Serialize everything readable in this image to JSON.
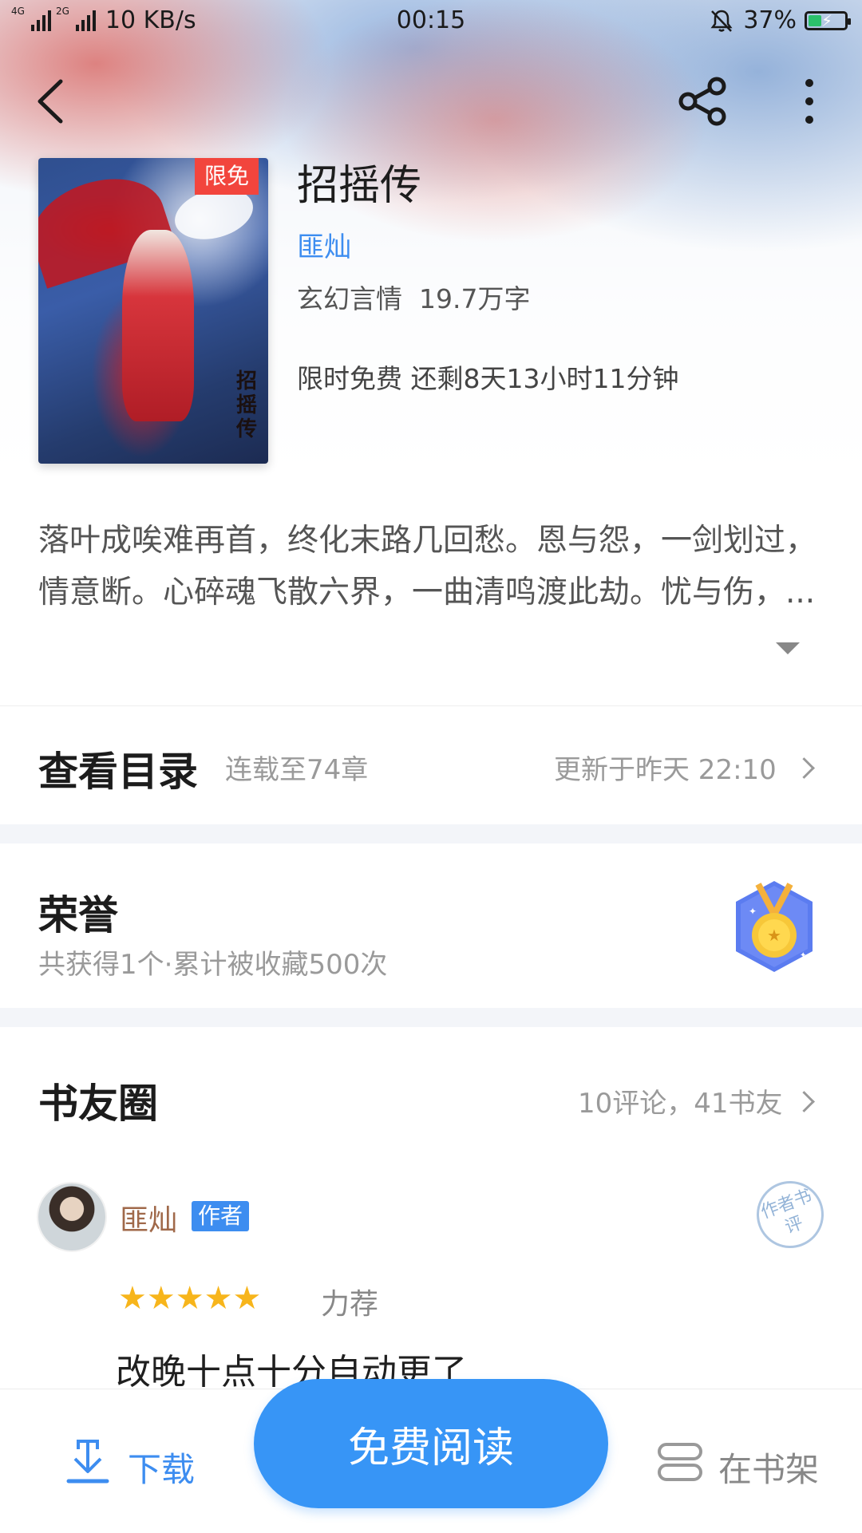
{
  "status_bar": {
    "network1": "4G",
    "network2": "2G",
    "speed": "10 KB/s",
    "time": "00:15",
    "battery": "37%",
    "battery_level": 0.37,
    "icons": [
      "signal-icon",
      "mute-bell-icon",
      "battery-icon"
    ]
  },
  "nav": {
    "back_icon": "back-arrow-icon",
    "share_icon": "share-icon",
    "more_icon": "more-vertical-icon"
  },
  "book": {
    "cover_badge": "限免",
    "cover_vertical_title": "招摇传",
    "title": "招摇传",
    "author": "匪灿",
    "meta": "玄幻言情  19.7万字",
    "free_info": "限时免费 还剩8天13小时11分钟"
  },
  "intro": {
    "text": "落叶成唉难再首，终化末路几回愁。恩与怨，一剑划过，情意断。心碎魂飞散六界，一曲清鸣渡此劫。忧与伤，..."
  },
  "catalog": {
    "title": "查看目录",
    "progress": "连载至74章",
    "updated": "更新于昨天 22:10"
  },
  "honor": {
    "title": "荣誉",
    "subtitle": "共获得1个·累计被收藏500次",
    "medal_icon": "medal-icon"
  },
  "circle": {
    "title": "书友圈",
    "summary": "10评论，41书友",
    "comment": {
      "author": "匪灿",
      "tag": "作者",
      "stamp": "作者书评",
      "rating": 5,
      "stars": "★★★★★",
      "rating_label": "力荐",
      "text": "改晚十点十分自动更了"
    }
  },
  "bottom": {
    "download": "下载",
    "read": "免费阅读",
    "shelf": "在书架"
  },
  "colors": {
    "accent": "#3795f6",
    "link": "#3d8df0",
    "badge": "#f2453d",
    "star": "#f7b51b"
  }
}
